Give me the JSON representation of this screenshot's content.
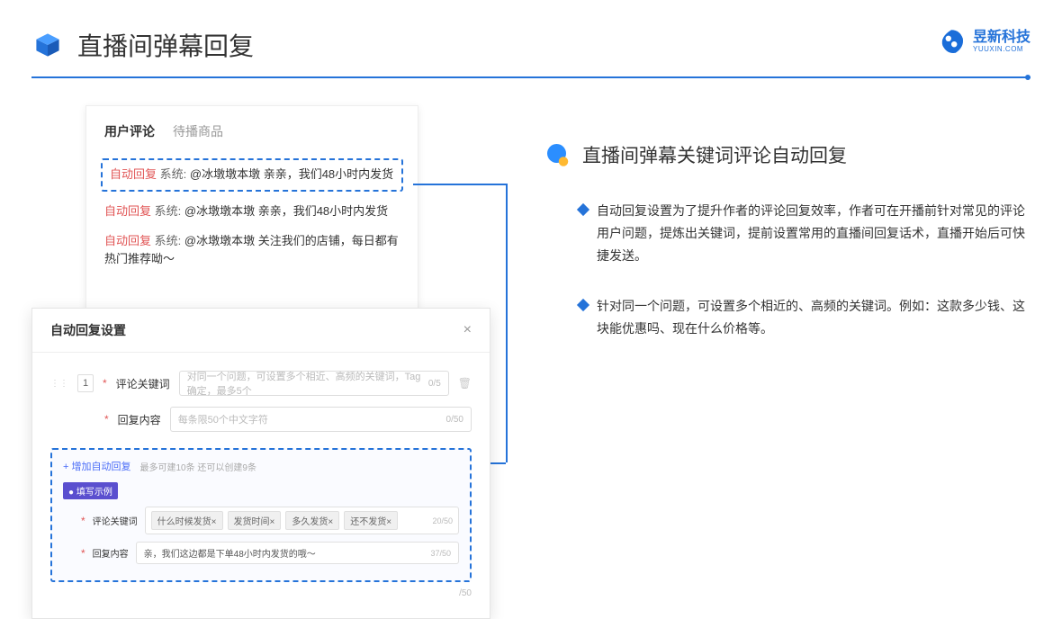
{
  "header": {
    "title": "直播间弹幕回复",
    "logo_name": "昱新科技",
    "logo_sub": "YUUXIN.COM"
  },
  "comments": {
    "tab_active": "用户评论",
    "tab_inactive": "待播商品",
    "auto_label": "自动回复",
    "sys_label": "系统:",
    "item1": "@冰墩墩本墩 亲亲，我们48小时内发货",
    "item2": "@冰墩墩本墩 亲亲，我们48小时内发货",
    "item3": "@冰墩墩本墩 关注我们的店铺，每日都有热门推荐呦～"
  },
  "modal": {
    "title": "自动回复设置",
    "row_num": "1",
    "keyword_label": "评论关键词",
    "keyword_placeholder": "对同一个问题，可设置多个相近、高频的关键词，Tag确定，最多5个",
    "keyword_counter": "0/5",
    "content_label": "回复内容",
    "content_placeholder": "每条限50个中文字符",
    "content_counter": "0/50",
    "add_link": "+ 增加自动回复",
    "add_hint": "最多可建10条 还可以创建9条",
    "example_badge": "● 填写示例",
    "ex_keyword_label": "评论关键词",
    "ex_tags": [
      "什么时候发货×",
      "发货时间×",
      "多久发货×",
      "还不发货×"
    ],
    "ex_kw_counter": "20/50",
    "ex_content_label": "回复内容",
    "ex_content": "亲，我们这边都是下单48小时内发货的哦～",
    "ex_content_counter": "37/50",
    "outer_counter": "/50"
  },
  "right": {
    "subtitle": "直播间弹幕关键词评论自动回复",
    "bullet1": "自动回复设置为了提升作者的评论回复效率，作者可在开播前针对常见的评论用户问题，提炼出关键词，提前设置常用的直播间回复话术，直播开始后可快捷发送。",
    "bullet2": "针对同一个问题，可设置多个相近的、高频的关键词。例如：这款多少钱、这块能优惠吗、现在什么价格等。"
  }
}
